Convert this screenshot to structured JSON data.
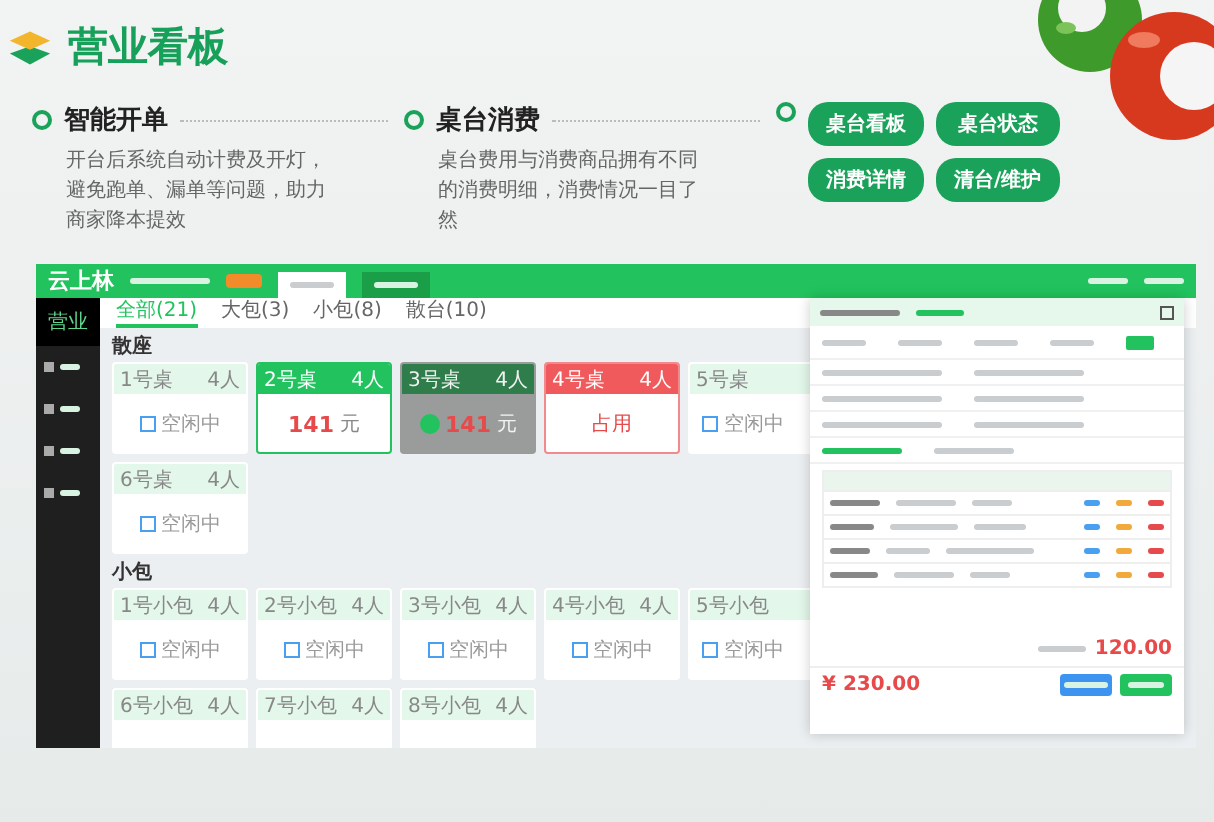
{
  "header": {
    "title": "营业看板"
  },
  "features": [
    {
      "title": "智能开单",
      "text": "开台后系统自动计费及开灯，避免跑单、漏单等问题，助力商家降本提效"
    },
    {
      "title": "桌台消费",
      "text": "桌台费用与消费商品拥有不同的消费明细，消费情况一目了然"
    }
  ],
  "feature_tags": [
    "桌台看板",
    "桌台状态",
    "消费详情",
    "清台/维护"
  ],
  "app": {
    "logo": "云上林",
    "sidebar": [
      {
        "label": "营业",
        "selected": true
      }
    ],
    "filter_tabs": [
      {
        "label": "全部(21)",
        "selected": true
      },
      {
        "label": "大包(3)",
        "selected": false
      },
      {
        "label": "小包(8)",
        "selected": false
      },
      {
        "label": "散台(10)",
        "selected": false
      }
    ],
    "sections": [
      {
        "title": "散座",
        "tables": [
          {
            "name": "1号桌",
            "seats": "4人",
            "kind": "idle",
            "status": "空闲中"
          },
          {
            "name": "2号桌",
            "seats": "4人",
            "kind": "billing",
            "amount": "141",
            "unit": "元"
          },
          {
            "name": "3号桌",
            "seats": "4人",
            "kind": "selected",
            "amount": "141",
            "unit": "元"
          },
          {
            "name": "4号桌",
            "seats": "4人",
            "kind": "occupied",
            "status": "占用"
          },
          {
            "name": "5号桌",
            "kind": "idle",
            "status": "空闲中"
          },
          {
            "name": "6号桌",
            "seats": "4人",
            "kind": "idle",
            "status": "空闲中"
          }
        ]
      },
      {
        "title": "小包",
        "tables": [
          {
            "name": "1号小包",
            "seats": "4人",
            "kind": "idle",
            "status": "空闲中"
          },
          {
            "name": "2号小包",
            "seats": "4人",
            "kind": "idle",
            "status": "空闲中"
          },
          {
            "name": "3号小包",
            "seats": "4人",
            "kind": "idle",
            "status": "空闲中"
          },
          {
            "name": "4号小包",
            "seats": "4人",
            "kind": "idle",
            "status": "空闲中"
          },
          {
            "name": "5号小包",
            "kind": "idle",
            "status": "空闲中"
          },
          {
            "name": "6号小包",
            "seats": "4人",
            "kind": "idle"
          },
          {
            "name": "7号小包",
            "seats": "4人",
            "kind": "idle"
          },
          {
            "name": "8号小包",
            "seats": "4人",
            "kind": "idle"
          }
        ]
      }
    ],
    "detail": {
      "subtotal": "120.00",
      "total": "¥ 230.00"
    }
  }
}
